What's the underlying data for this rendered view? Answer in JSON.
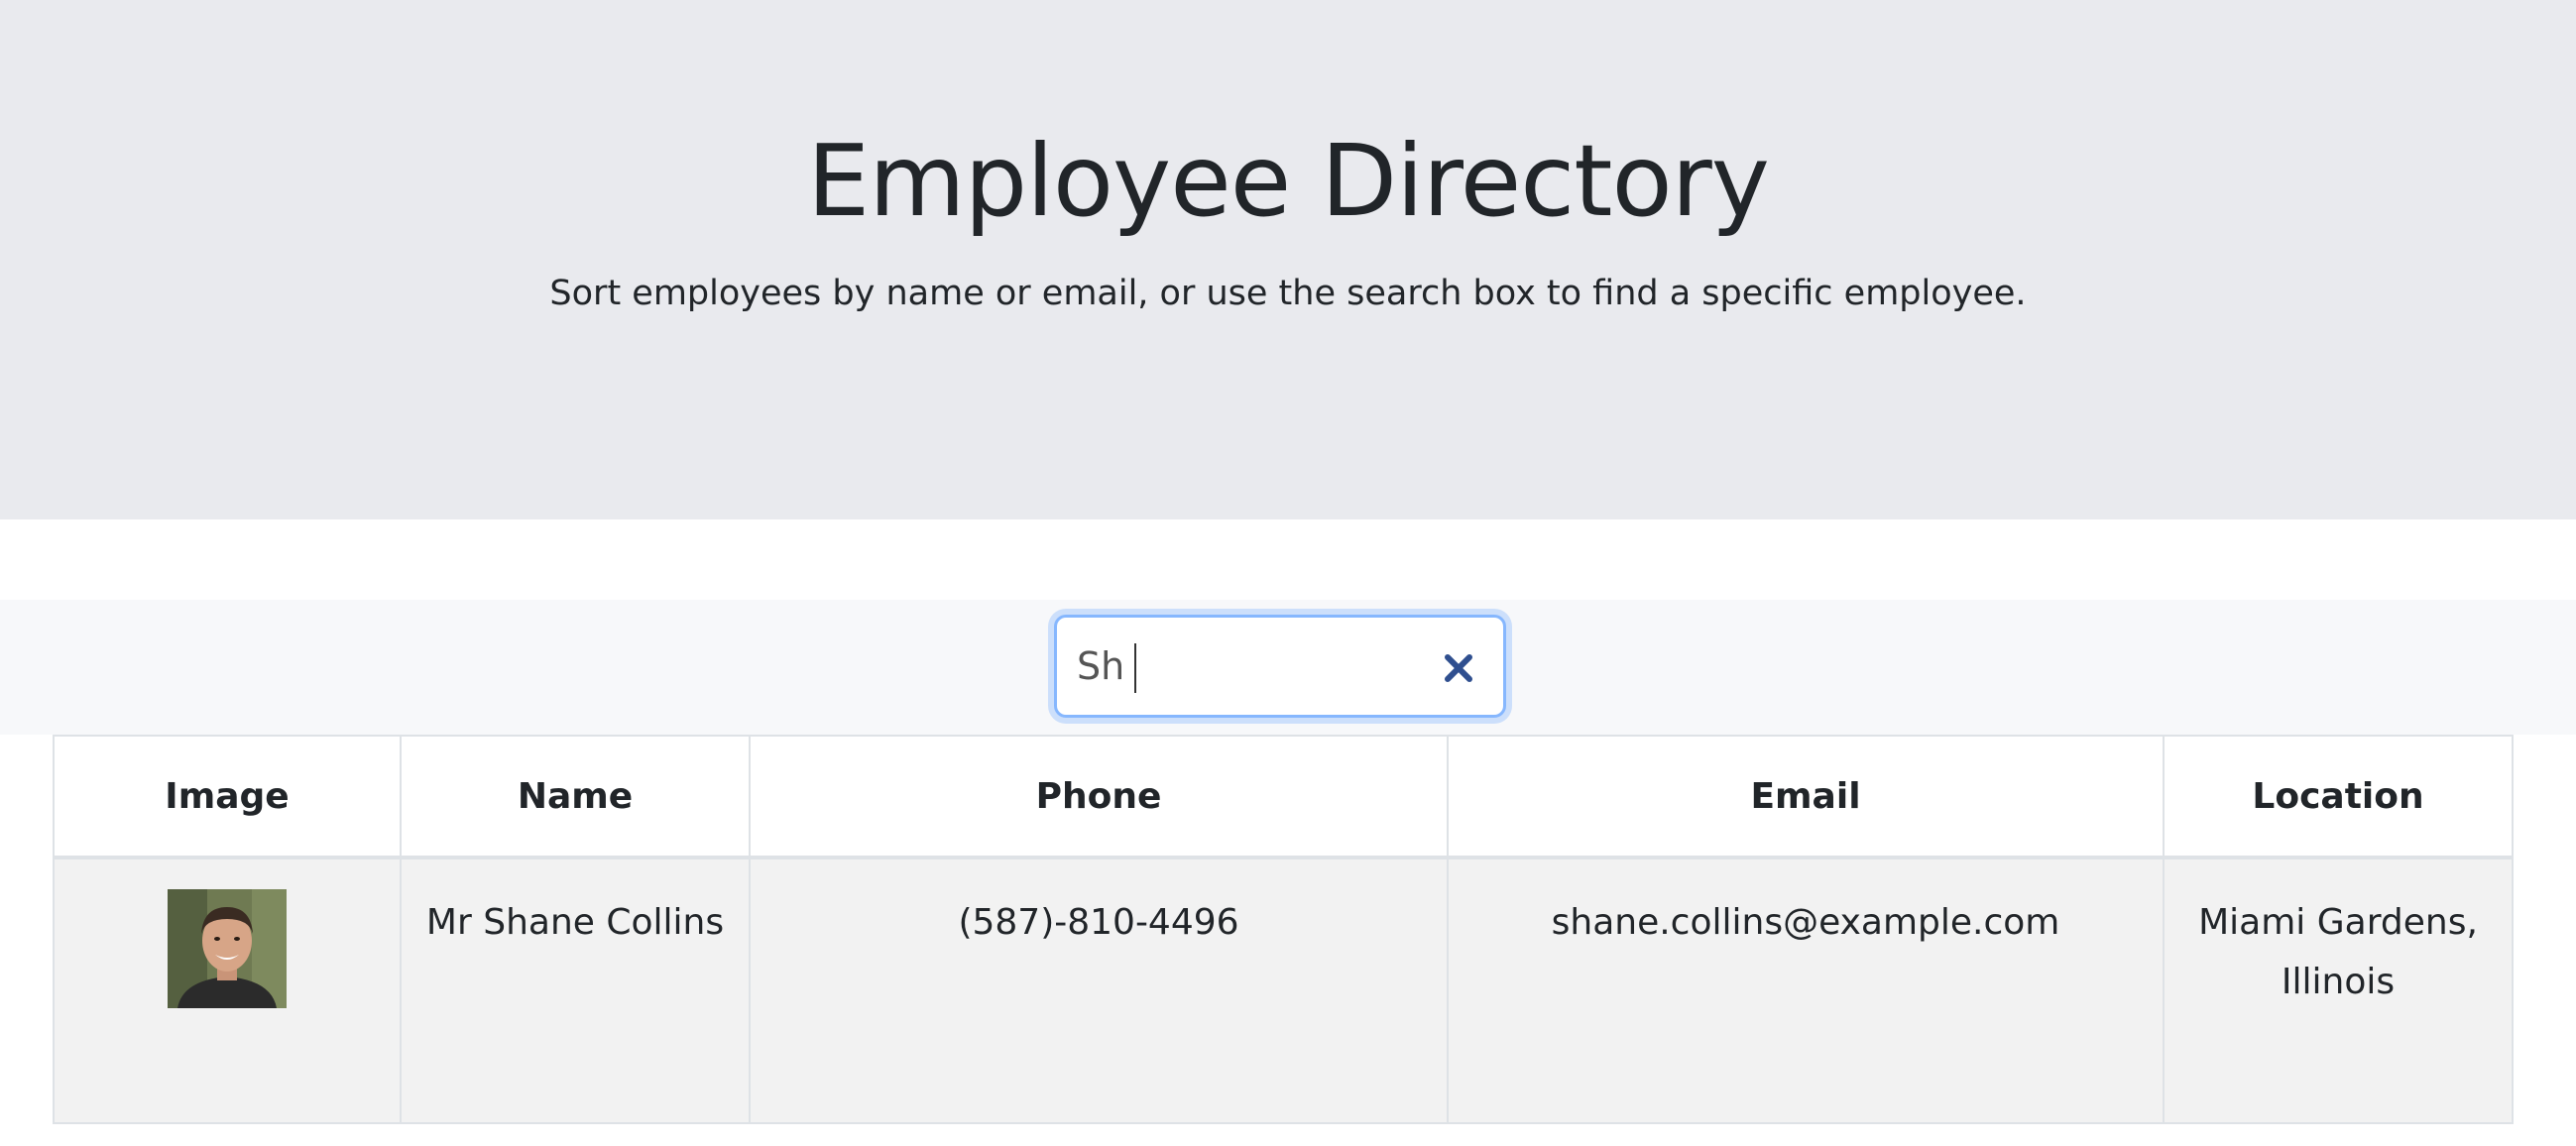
{
  "header": {
    "title": "Employee Directory",
    "subtitle": "Sort employees by name or email, or use the search box to find a specific employee."
  },
  "search": {
    "value": "Sh"
  },
  "table": {
    "columns": [
      "Image",
      "Name",
      "Phone",
      "Email",
      "Location"
    ],
    "rows": [
      {
        "name": "Mr Shane Collins",
        "phone": "(587)-810-4496",
        "email": "shane.collins@example.com",
        "location": "Miami Gardens, Illinois"
      }
    ]
  },
  "colors": {
    "hero_bg": "#e9eaee",
    "focus_ring": "#86b7fe",
    "clear_icon": "#2f4f8f",
    "row_bg": "#f2f2f2"
  },
  "icons": {
    "clear": "close-icon",
    "avatar": "employee-photo"
  }
}
